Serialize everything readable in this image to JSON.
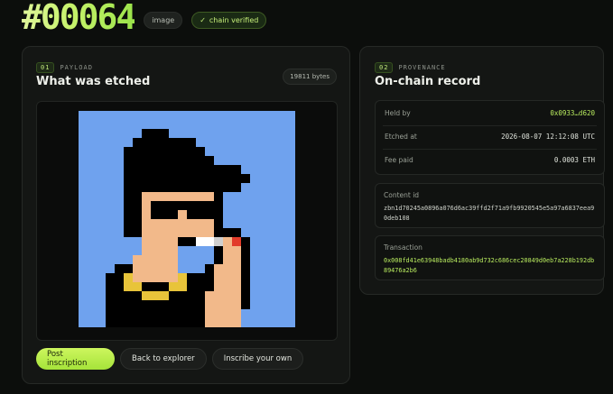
{
  "header": {
    "id": "#00064",
    "type_badge": "image",
    "verified_badge": "chain verified",
    "verified_icon": "✓"
  },
  "payload": {
    "num": "01",
    "label": "PAYLOAD",
    "title": "What was etched",
    "bytes": "19811 bytes"
  },
  "provenance": {
    "num": "02",
    "label": "PROVENANCE",
    "title": "On-chain record",
    "held_by_label": "Held by",
    "held_by_value": "0x0933…d620",
    "etched_at_label": "Etched at",
    "etched_at_value": "2026-08-07 12:12:08 UTC",
    "fee_label": "Fee paid",
    "fee_value": "0.0003 ETH",
    "content_id_label": "Content id",
    "content_id_value": "zbn1d70245a0896a076d6ac39ffd2f71a9fb9920545e5a97a6837eea90deb108",
    "tx_label": "Transaction",
    "tx_value": "0x008fd41e63948badb4180ab9d732c686cec20849d0eb7a228b192db89476a2b6"
  },
  "actions": {
    "post": "Post inscription",
    "back": "Back to explorer",
    "inscribe": "Inscribe your own"
  },
  "colors": {
    "accent": "#b9ec5f",
    "art_bg": "#6fa2ee",
    "skin": "#f2b98a"
  }
}
